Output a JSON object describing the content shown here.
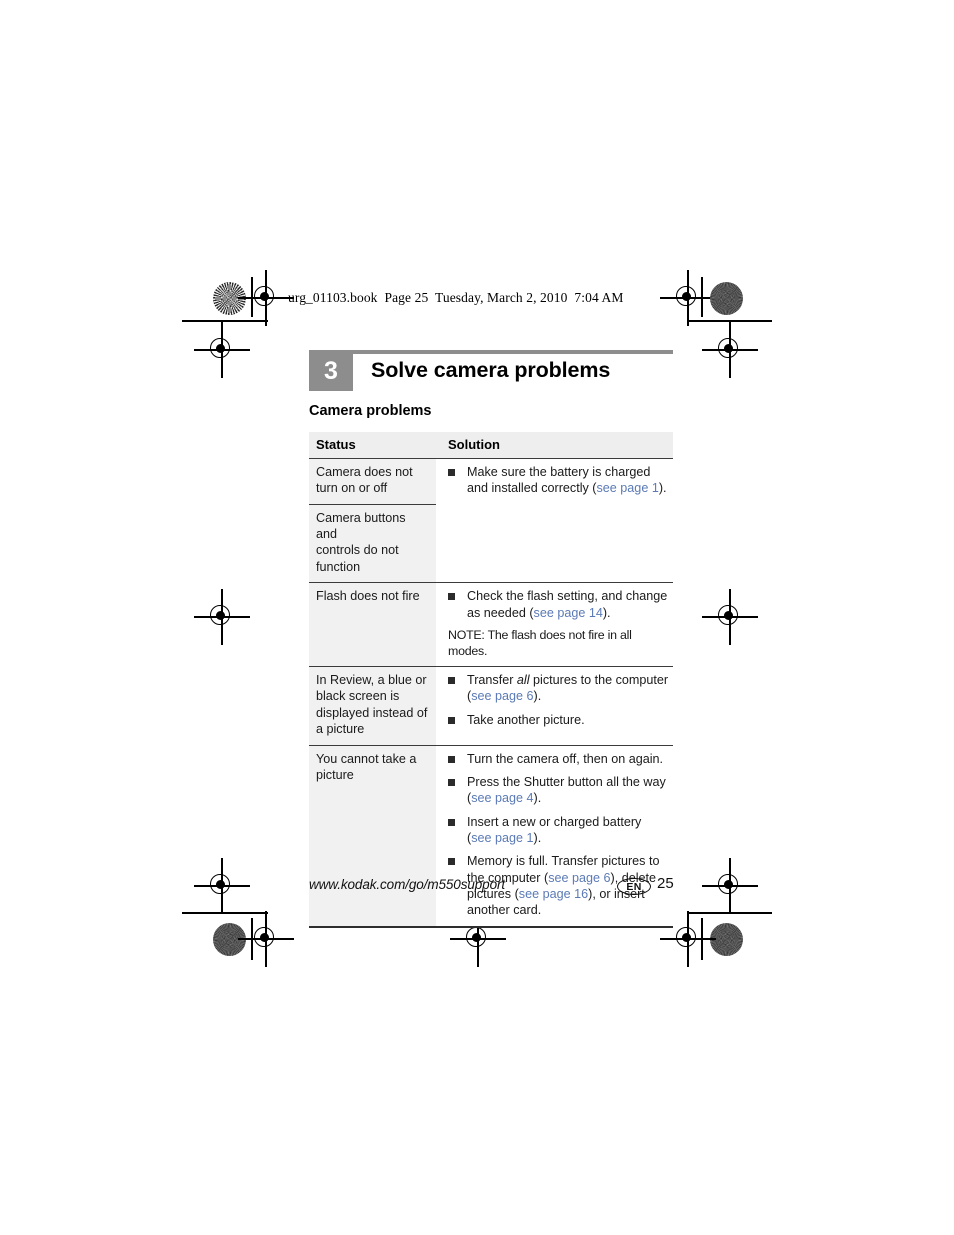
{
  "page_header": "urg_01103.book  Page 25  Tuesday, March 2, 2010  7:04 AM",
  "chapter": {
    "number": "3",
    "title": "Solve camera problems"
  },
  "section": {
    "heading": "Camera problems"
  },
  "table": {
    "columns": [
      "Status",
      "Solution"
    ],
    "rows": [
      {
        "status": "Camera does not\nturn on or off",
        "status2": "Camera buttons and\ncontrols do not function",
        "bullets": [
          "Make sure the battery is charged and installed correctly (see page 1)."
        ]
      },
      {
        "status": "Flash does not fire",
        "bullets": [
          "Check the flash setting, and change as needed (see page 14)."
        ],
        "note": "NOTE:  The flash does not fire in all modes."
      },
      {
        "status": "In Review, a blue or black screen is displayed instead of a picture",
        "bullets": [
          "Transfer all pictures to the computer (see page 6).",
          "Take another picture."
        ]
      },
      {
        "status": "You cannot take a picture",
        "bullets": [
          "Turn the camera off, then on again.",
          "Press the Shutter button all the way (see page 4).",
          "Insert a new or charged battery (see page 1).",
          "Memory is full. Transfer pictures to the computer (see page 6), delete pictures (see page 16), or insert another card."
        ]
      }
    ]
  },
  "footer": {
    "url": "www.kodak.com/go/m550support",
    "language": "EN",
    "page_number": "25"
  },
  "links": {
    "page1": "see page 1",
    "page4": "see page 4",
    "page6": "see page 6",
    "page14": "see page 14",
    "page16": "see page 16"
  },
  "colors": {
    "link": "#5b7ab5",
    "chapter_bar": "#8d8d8d",
    "status_cell": "#f1f1f1",
    "header_cell": "#eeeeee"
  }
}
